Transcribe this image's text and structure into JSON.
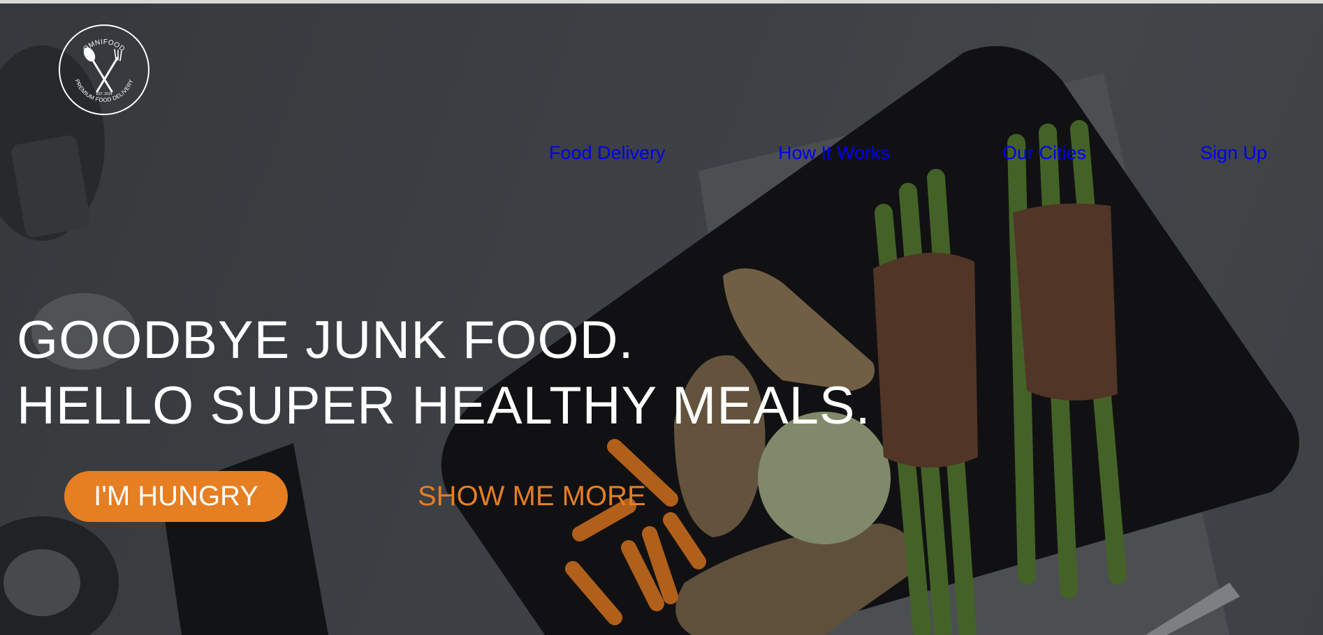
{
  "logo": {
    "top_text": "OMNIFOOD",
    "bottom_text": "PREMIUM FOOD DELIVERY",
    "est_text": "EST. 2014"
  },
  "nav": {
    "items": [
      {
        "label": "Food Delivery"
      },
      {
        "label": "How It Works"
      },
      {
        "label": "Our Cities"
      },
      {
        "label": "Sign Up"
      }
    ]
  },
  "hero": {
    "headline_line1": "GOODBYE JUNK FOOD.",
    "headline_line2": "HELLO SUPER HEALTHY MEALS.",
    "primary_button": "I'M HUNGRY",
    "secondary_button": "SHOW ME MORE"
  },
  "colors": {
    "accent": "#e67e22",
    "nav_link": "#0000ee",
    "text": "#ffffff"
  }
}
